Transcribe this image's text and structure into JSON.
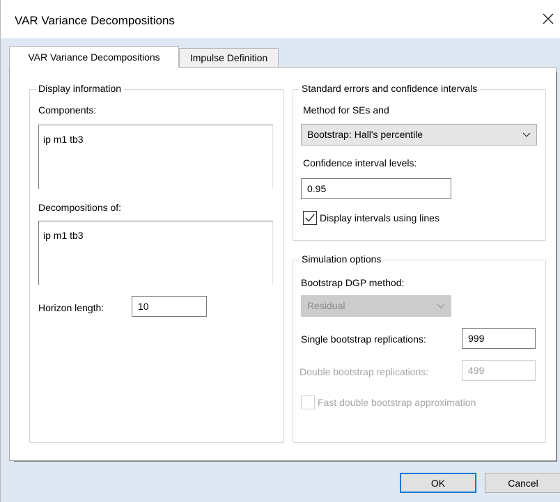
{
  "window": {
    "title": "VAR Variance Decompositions",
    "close_icon": "close-icon"
  },
  "tabs": [
    {
      "label": "VAR Variance Decompositions",
      "active": true
    },
    {
      "label": "Impulse Definition",
      "active": false
    }
  ],
  "display_information": {
    "legend": "Display information",
    "components_label": "Components:",
    "components_value": "ip m1 tb3",
    "decompositions_label": "Decompositions of:",
    "decompositions_value": "ip m1 tb3",
    "horizon_label": "Horizon length:",
    "horizon_value": "10"
  },
  "standard_errors": {
    "legend": "Standard errors and confidence intervals",
    "method_label": "Method for SEs and",
    "method_value": "Bootstrap: Hall's percentile",
    "ci_label": "Confidence interval levels:",
    "ci_value": "0.95",
    "display_lines_label": "Display intervals using lines",
    "display_lines_checked": true
  },
  "simulation_options": {
    "legend": "Simulation options",
    "dgp_label": "Bootstrap DGP method:",
    "dgp_value": "Residual",
    "single_label": "Single bootstrap replications:",
    "single_value": "999",
    "double_label": "Double bootstrap replications:",
    "double_value": "499",
    "fast_label": "Fast double bootstrap approximation",
    "fast_checked": false
  },
  "buttons": {
    "ok": "OK",
    "cancel": "Cancel"
  }
}
